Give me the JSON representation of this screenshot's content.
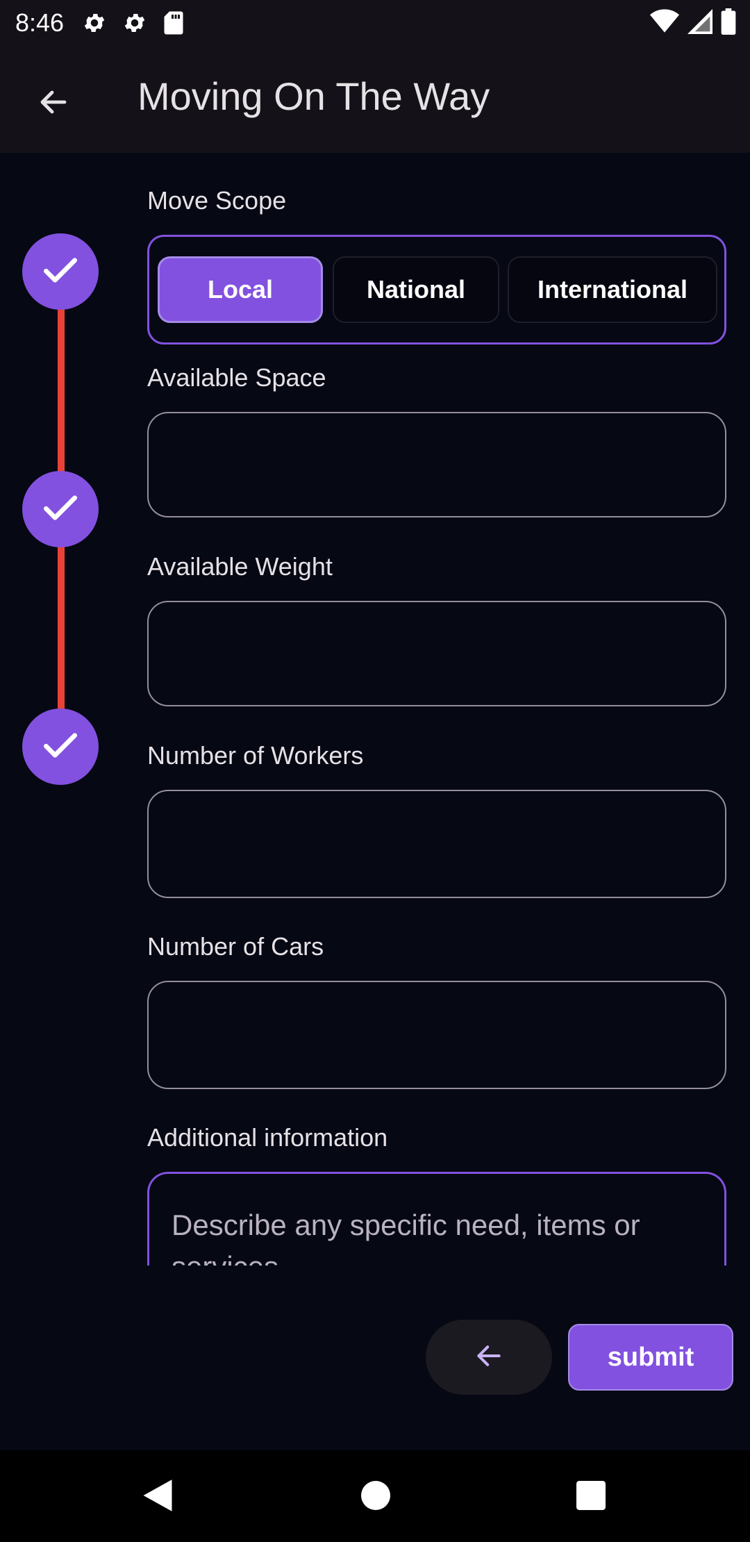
{
  "status_bar": {
    "time": "8:46",
    "icons": [
      "settings-gear-icon",
      "settings-gear-icon",
      "sd-card-icon",
      "wifi-icon",
      "signal-icon",
      "battery-icon"
    ]
  },
  "app_bar": {
    "title": "Moving On The Way",
    "back_icon": "arrow-left-icon"
  },
  "stepper": {
    "steps": [
      {
        "state": "complete",
        "icon": "check-icon"
      },
      {
        "state": "complete",
        "icon": "check-icon"
      },
      {
        "state": "complete",
        "icon": "check-icon"
      }
    ],
    "accent_color": "#8251df",
    "line_color": "#e84236"
  },
  "form": {
    "move_scope": {
      "label": "Move Scope",
      "options": [
        "Local",
        "National",
        "International"
      ],
      "selected": "Local"
    },
    "available_space": {
      "label": "Available Space",
      "value": ""
    },
    "available_weight": {
      "label": "Available Weight",
      "value": ""
    },
    "number_of_workers": {
      "label": "Number of Workers",
      "value": ""
    },
    "number_of_cars": {
      "label": "Number of Cars",
      "value": ""
    },
    "additional_information": {
      "label": "Additional information",
      "placeholder": "Describe any specific need, items or services"
    }
  },
  "actions": {
    "previous_icon": "arrow-left-icon",
    "submit_label": "submit"
  },
  "nav_bar": {
    "icons": [
      "back-triangle-icon",
      "home-circle-icon",
      "recents-square-icon"
    ]
  }
}
